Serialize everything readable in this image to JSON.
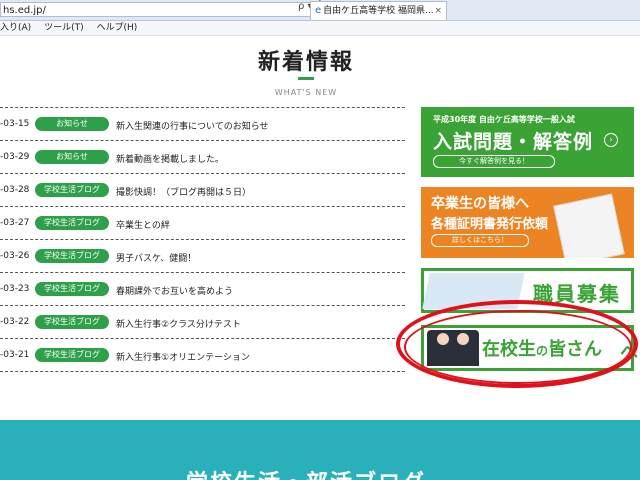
{
  "browser": {
    "address": "hs.ed.jp/",
    "address_icons": "ρ ▾ Ċ",
    "tab_title": "自由ケ丘高等学校 福岡県...",
    "tab_close": "×",
    "menu": [
      "入り(A)",
      "ツール(T)",
      "ヘルプ(H)"
    ]
  },
  "section": {
    "title": "新着情報",
    "subtitle": "WHAT'S NEW"
  },
  "news": [
    {
      "date": "-03-15",
      "badge": "お知らせ",
      "title": "新入生関連の行事についてのお知らせ"
    },
    {
      "date": "-03-29",
      "badge": "お知らせ",
      "title": "新着動画を掲載しました。"
    },
    {
      "date": "-03-28",
      "badge": "学校生活ブログ",
      "title": "撮影快調！（ブログ再開は５日）"
    },
    {
      "date": "-03-27",
      "badge": "学校生活ブログ",
      "title": "卒業生との絆"
    },
    {
      "date": "-03-26",
      "badge": "学校生活ブログ",
      "title": "男子バスケ、健闘！"
    },
    {
      "date": "-03-23",
      "badge": "学校生活ブログ",
      "title": "春期課外でお互いを高めよう"
    },
    {
      "date": "-03-22",
      "badge": "学校生活ブログ",
      "title": "新入生行事②クラス分けテスト"
    },
    {
      "date": "-03-21",
      "badge": "学校生活ブログ",
      "title": "新入生行事①オリエンテーション"
    }
  ],
  "banners": {
    "exam": {
      "line1": "平成30年度 自由ケ丘高等学校一般入試",
      "line2": "入試問題・解答例",
      "arrow": "›",
      "button": "今すぐ解答例を見る！"
    },
    "graduates": {
      "line1": "卒業生の皆様へ",
      "line2": "各種証明書発行依頼",
      "button": "詳しくはこちら！"
    },
    "staff": {
      "text": "職員募集"
    },
    "students": {
      "text_a": "在校生",
      "text_b": "の",
      "text_c": "皆さん",
      "arrow": "へ"
    }
  },
  "footer": {
    "title": "学校生活・部活ブログ"
  },
  "colors": {
    "green": "#3ba235",
    "orange": "#ec8423",
    "teal": "#2ab0ba",
    "highlight": "#e0111b"
  }
}
